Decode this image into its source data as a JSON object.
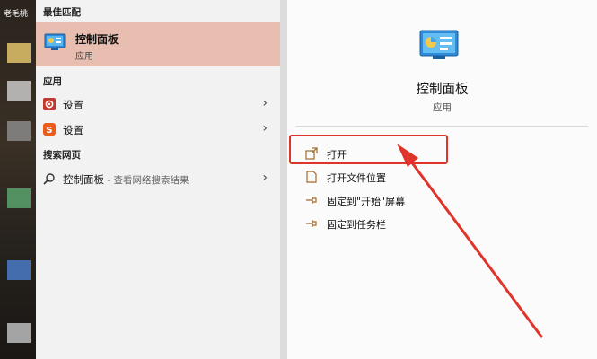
{
  "desktop": {
    "label": "老毛桃"
  },
  "results": {
    "best_match_header": "最佳匹配",
    "best_match": {
      "title": "控制面板",
      "subtitle": "应用"
    },
    "apps_header": "应用",
    "apps": [
      {
        "label": "设置",
        "icon": "gear-icon",
        "color": "#c0392b"
      },
      {
        "label": "设置",
        "icon": "sougou-s-icon",
        "color": "#e85d1a"
      }
    ],
    "web_header": "搜索网页",
    "web_result": {
      "label": "控制面板",
      "suffix": " - 查看网络搜索结果"
    }
  },
  "preview": {
    "title": "控制面板",
    "subtitle": "应用",
    "actions": [
      {
        "label": "打开",
        "icon": "open-icon"
      },
      {
        "label": "打开文件位置",
        "icon": "file-location-icon"
      },
      {
        "label": "固定到\"开始\"屏幕",
        "icon": "pin-icon"
      },
      {
        "label": "固定到任务栏",
        "icon": "pin-icon"
      }
    ]
  },
  "colors": {
    "accent": "#e8beb0",
    "annotation": "#e0342a"
  }
}
